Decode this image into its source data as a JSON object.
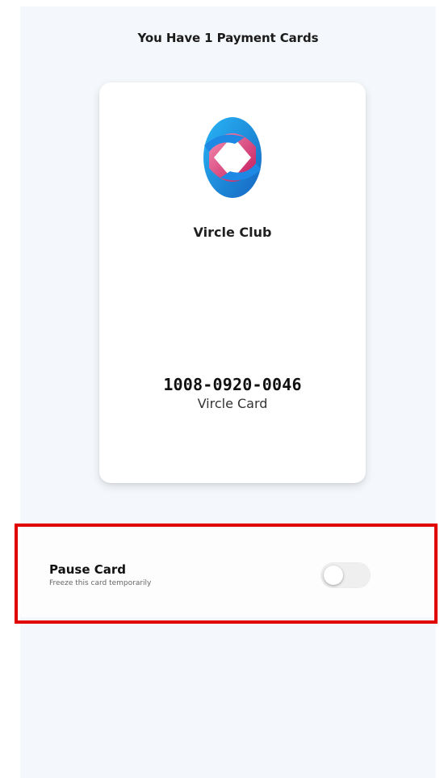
{
  "header": {
    "title": "You Have 1 Payment Cards"
  },
  "card": {
    "club_name": "Vircle Club",
    "number": "1008-0920-0046",
    "type_label": "Vircle Card"
  },
  "pause": {
    "title": "Pause Card",
    "subtitle": "Freeze this card temporarily",
    "enabled": false
  },
  "icons": {
    "logo": "vircle-logo-icon"
  },
  "colors": {
    "background": "#f4f7fb",
    "highlight": "#e10000",
    "logo_blue": "#1e88e5",
    "logo_pink": "#ec407a"
  }
}
